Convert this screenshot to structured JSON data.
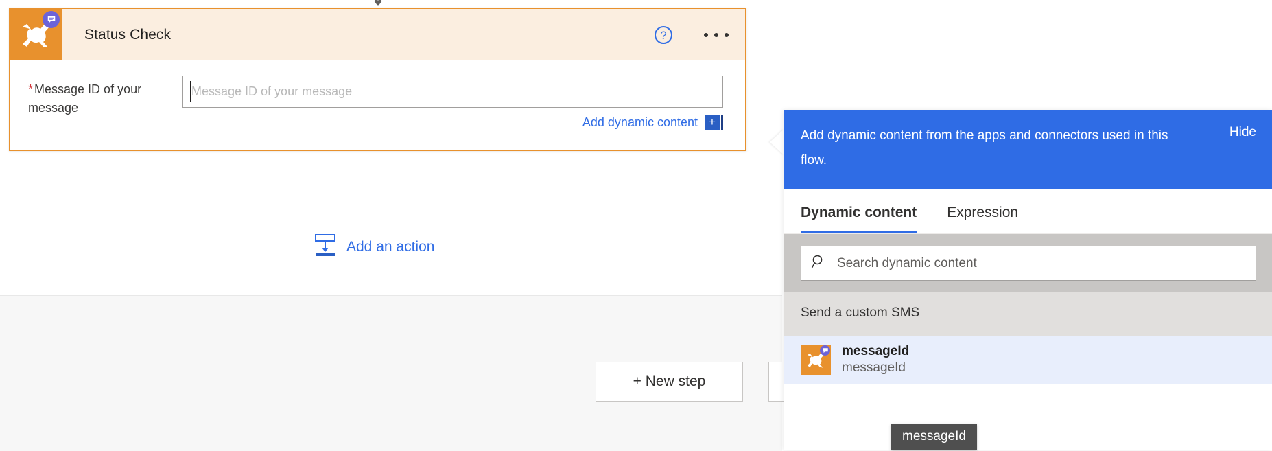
{
  "flow": {
    "arrow_icon": "chevron-down-icon",
    "card": {
      "title": "Status Check",
      "icon_name": "twilio-connector-icon",
      "badge_icon": "message-bubble-icon",
      "help_label": "?",
      "overflow_label": "•••",
      "field": {
        "required_marker": "*",
        "label": "Message ID of your message",
        "placeholder": "Message ID of your message",
        "value": ""
      },
      "dynamic_link": {
        "label": "Add dynamic content",
        "plus_label": "+"
      }
    },
    "add_action": {
      "label": "Add an action",
      "icon_name": "insert-action-icon"
    },
    "buttons": {
      "new_step": "+ New step",
      "secondary": ""
    }
  },
  "dynamic_panel": {
    "banner": {
      "message": "Add dynamic content from the apps and connectors used in this flow.",
      "hide_label": "Hide"
    },
    "tabs": [
      {
        "label": "Dynamic content",
        "active": true
      },
      {
        "label": "Expression",
        "active": false
      }
    ],
    "search": {
      "placeholder": "Search dynamic content",
      "value": "",
      "icon_name": "search-icon"
    },
    "groups": [
      {
        "header": "Send a custom SMS",
        "items": [
          {
            "title": "messageId",
            "subtitle": "messageId",
            "icon_name": "twilio-connector-icon",
            "badge_icon": "message-bubble-icon",
            "selected": true
          }
        ]
      }
    ],
    "tooltip": "messageId"
  },
  "colors": {
    "accent_orange": "#e8912d",
    "card_header_bg": "#fbeee0",
    "link_blue": "#2f6ce5",
    "banner_blue": "#2f6ce5",
    "required_red": "#d13438",
    "selected_item_bg": "#e8eefc",
    "tooltip_bg": "#4f4f4f"
  }
}
